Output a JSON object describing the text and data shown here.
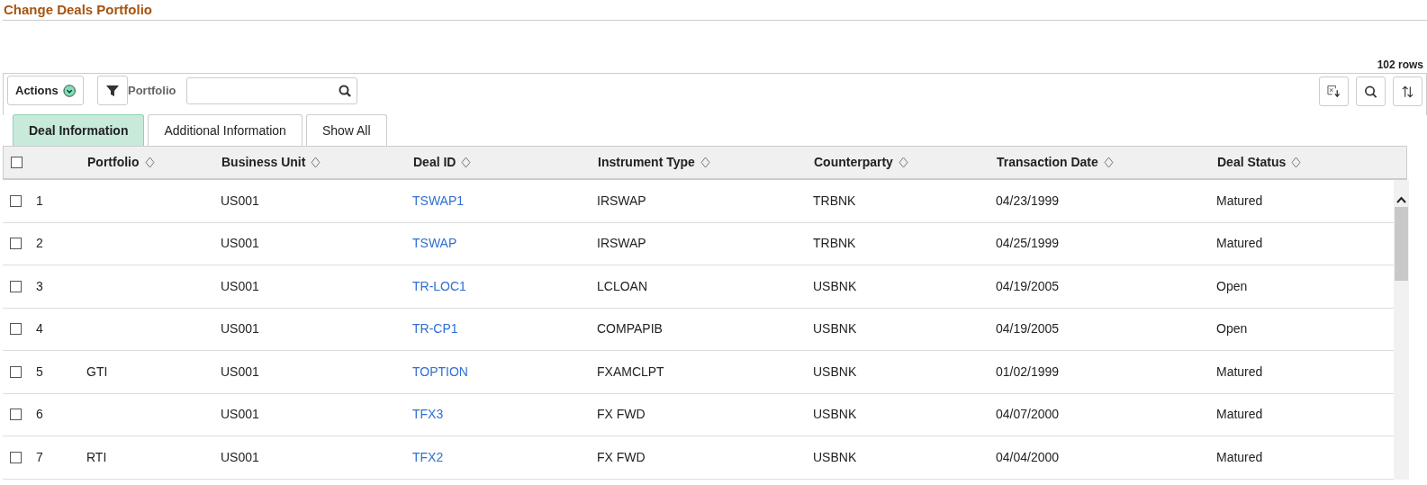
{
  "page_title": "Change Deals Portfolio",
  "row_count": "102 rows",
  "toolbar": {
    "actions_label": "Actions",
    "filter_label": "Portfolio"
  },
  "tabs": [
    {
      "label": "Deal Information",
      "selected": true
    },
    {
      "label": "Additional Information",
      "selected": false
    },
    {
      "label": "Show All",
      "selected": false
    }
  ],
  "table": {
    "select_all_checked": false,
    "columns": [
      "Portfolio",
      "Business Unit",
      "Deal ID",
      "Instrument Type",
      "Counterparty",
      "Transaction Date",
      "Deal Status"
    ],
    "rows": [
      {
        "checked": false,
        "number": "1",
        "portfolio": "",
        "business_unit": "US001",
        "deal_id": "TSWAP1",
        "instrument_type": "IRSWAP",
        "counterparty": "TRBNK",
        "transaction_date": "04/23/1999",
        "deal_status": "Matured"
      },
      {
        "checked": false,
        "number": "2",
        "portfolio": "",
        "business_unit": "US001",
        "deal_id": "TSWAP",
        "instrument_type": "IRSWAP",
        "counterparty": "TRBNK",
        "transaction_date": "04/25/1999",
        "deal_status": "Matured"
      },
      {
        "checked": false,
        "number": "3",
        "portfolio": "",
        "business_unit": "US001",
        "deal_id": "TR-LOC1",
        "instrument_type": "LCLOAN",
        "counterparty": "USBNK",
        "transaction_date": "04/19/2005",
        "deal_status": "Open"
      },
      {
        "checked": false,
        "number": "4",
        "portfolio": "",
        "business_unit": "US001",
        "deal_id": "TR-CP1",
        "instrument_type": "COMPAPIB",
        "counterparty": "USBNK",
        "transaction_date": "04/19/2005",
        "deal_status": "Open"
      },
      {
        "checked": false,
        "number": "5",
        "portfolio": "GTI",
        "business_unit": "US001",
        "deal_id": "TOPTION",
        "instrument_type": "FXAMCLPT",
        "counterparty": "USBNK",
        "transaction_date": "01/02/1999",
        "deal_status": "Matured"
      },
      {
        "checked": false,
        "number": "6",
        "portfolio": "",
        "business_unit": "US001",
        "deal_id": "TFX3",
        "instrument_type": "FX FWD",
        "counterparty": "USBNK",
        "transaction_date": "04/07/2000",
        "deal_status": "Matured"
      },
      {
        "checked": false,
        "number": "7",
        "portfolio": "RTI",
        "business_unit": "US001",
        "deal_id": "TFX2",
        "instrument_type": "FX FWD",
        "counterparty": "USBNK",
        "transaction_date": "04/04/2000",
        "deal_status": "Matured"
      }
    ]
  }
}
